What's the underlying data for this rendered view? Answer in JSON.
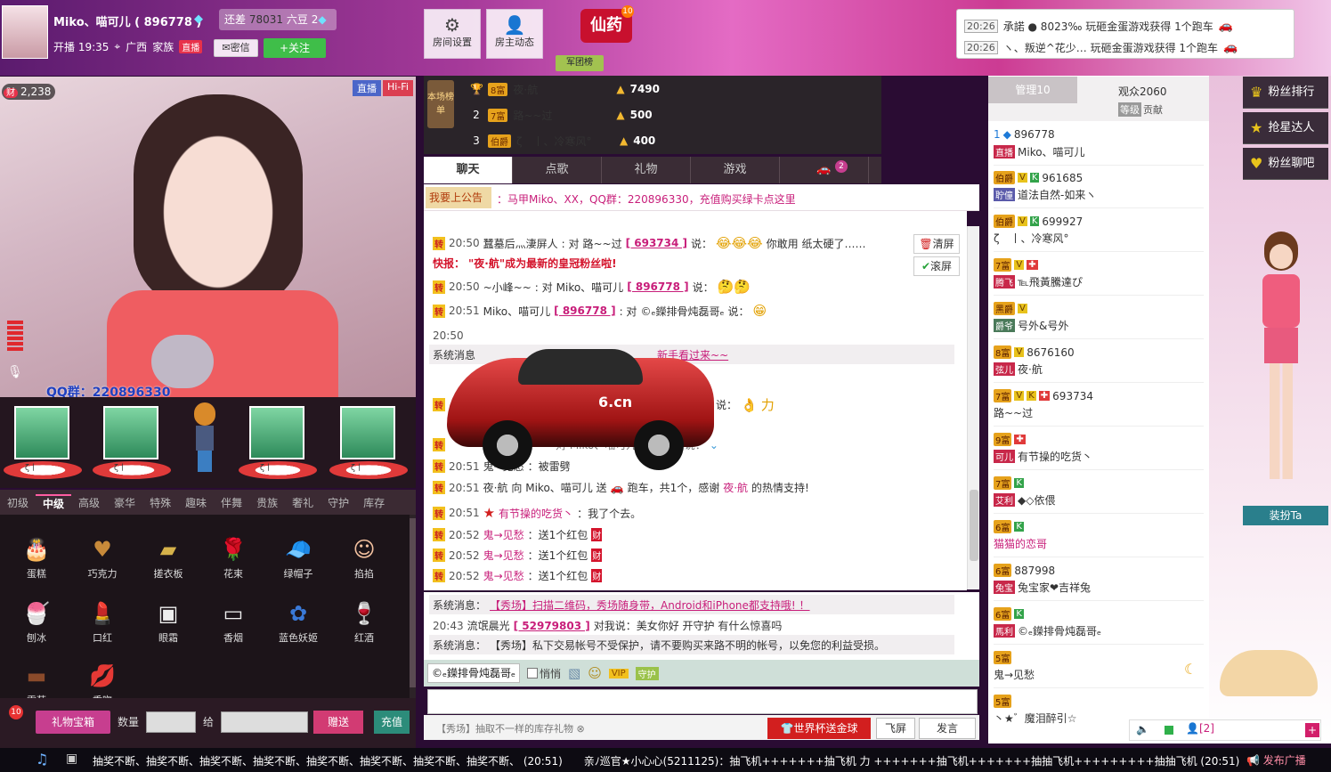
{
  "header": {
    "host_name": "Miko、喵可儿 ( 896778 )",
    "gap_label": "还差",
    "gap_value": "78031",
    "gap_unit": "六豆",
    "gap_level": "2",
    "start_label": "开播 19:35",
    "location": "广西",
    "family_label": "家族",
    "family_badge": "直播",
    "msg_btn": "密信",
    "follow_btn": "+关注",
    "room_settings": "房间设置",
    "host_updates": "房主动态",
    "xianyao": "仙药",
    "xianyao_badge": "10",
    "legion_rank": "军团榜"
  },
  "notices": [
    {
      "time": "20:26",
      "text": "承諾 ● 8023‰ 玩砸金蛋游戏获得 1个跑车"
    },
    {
      "time": "20:26",
      "text": "ヽ、叛逆^花少… 玩砸金蛋游戏获得 1个跑车"
    }
  ],
  "video": {
    "wealth": "2,238",
    "wealth_tag": "财",
    "tag_live": "直播",
    "tag_hifi": "Hi-Fi",
    "qq": "QQ群：220896330"
  },
  "podiums": [
    {
      "cap": "ζ丨"
    },
    {
      "cap": "ζ丨"
    },
    {
      "cap": "ζ丨"
    },
    {
      "cap": "ζ丨"
    }
  ],
  "gift_tabs": [
    "初级",
    "中级",
    "高级",
    "豪华",
    "特殊",
    "趣味",
    "伴舞",
    "贵族",
    "奢礼",
    "守护",
    "库存"
  ],
  "gifts": [
    {
      "name": "蛋糕",
      "icon": "cake-icon",
      "glyph": "🎂"
    },
    {
      "name": "巧克力",
      "icon": "chocolate-icon",
      "glyph": "♥"
    },
    {
      "name": "搓衣板",
      "icon": "washboard-icon",
      "glyph": "▰"
    },
    {
      "name": "花束",
      "icon": "bouquet-icon",
      "glyph": "🌹"
    },
    {
      "name": "绿帽子",
      "icon": "green-hat-icon",
      "glyph": "🧢"
    },
    {
      "name": "掐掐",
      "icon": "pinch-icon",
      "glyph": "☺"
    },
    {
      "name": "刨冰",
      "icon": "shaved-ice-icon",
      "glyph": "🍧"
    },
    {
      "name": "口红",
      "icon": "lipstick-icon",
      "glyph": "💄"
    },
    {
      "name": "眼霜",
      "icon": "eye-cream-icon",
      "glyph": "▣"
    },
    {
      "name": "香烟",
      "icon": "cigarette-icon",
      "glyph": "▭"
    },
    {
      "name": "蓝色妖姬",
      "icon": "blue-rose-icon",
      "glyph": "✿"
    },
    {
      "name": "红酒",
      "icon": "wine-icon",
      "glyph": "🍷"
    },
    {
      "name": "雪茄",
      "icon": "cigar-icon",
      "glyph": "▬"
    },
    {
      "name": "香吻",
      "icon": "kiss-icon",
      "glyph": "💋"
    }
  ],
  "gift_bottom": {
    "badge": "10",
    "box_btn": "礼物宝箱",
    "qty_label": "数量",
    "to_label": "给",
    "send_btn": "赠送",
    "recharge_btn": "充值"
  },
  "ranking": {
    "badge": "本场榜单",
    "rows": [
      {
        "rank": "1",
        "level": "8富",
        "name": "夜·航",
        "value": "7490"
      },
      {
        "rank": "2",
        "level": "7富",
        "name": "路~~过",
        "value": "500"
      },
      {
        "rank": "3",
        "level": "伯爵",
        "name": "ζ　丨、冷寒风°",
        "value": "400"
      }
    ]
  },
  "chat_tabs": [
    "聊天",
    "点歌",
    "礼物",
    "游戏",
    ""
  ],
  "car_badge": "2",
  "announce": {
    "tag": "我要上公告",
    "text": "：马甲Miko、XX，QQ群：220896330，充值购买绿卡点这里"
  },
  "chat_controls": {
    "clear": "清屏",
    "scroll": "滚屏"
  },
  "chat": {
    "l1": {
      "tag": "转",
      "time": "20:50",
      "from": "蠶墓后灬淒屏人",
      "to": "路~~过",
      "rid": "[ 693734 ]",
      "said": "说：",
      "tail": "你敢用 纸太硬了……"
    },
    "l2": {
      "prefix": "快报：",
      "text": "\"夜·航\"成为最新的皇冠粉丝啦!"
    },
    "l3": {
      "tag": "转",
      "time": "20:50",
      "from": "~小峰~~",
      "to": "Miko、喵可儿",
      "rid": "[ 896778 ]",
      "said": "说："
    },
    "l4": {
      "tag": "转",
      "time": "20:51",
      "from": "Miko、喵可儿",
      "rid": "[ 896778 ]",
      "to": "©ₑ鑅排骨炖磊哥ₑ",
      "said": "说："
    },
    "l5": {
      "time": "20:50"
    },
    "l6": {
      "label": "系统消息",
      "link": "新手看过来~~"
    },
    "l7": {
      "tag": "转",
      "said": "说：",
      "tail": "力"
    },
    "l8": {
      "tag": "转",
      "text": "对 Miko、喵可儿 896778 说："
    },
    "l9": {
      "tag": "转",
      "time": "20:51",
      "from": "鬼→见愁",
      "text": "：被雷劈"
    },
    "l10": {
      "tag": "转",
      "time": "20:51",
      "from": "夜·航",
      "mid": "向 Miko、喵可儿 送",
      "gift": "跑车，共1个，感谢",
      "who": "夜·航",
      "tail": "的热情支持!"
    },
    "l11": {
      "tag": "转",
      "time": "20:51",
      "from": "有节操的吃货丶",
      "text": "：我了个去。"
    },
    "l12": {
      "tag": "转",
      "time": "20:52",
      "from": "鬼→见愁",
      "text": "：送1个红包",
      "hb": "财"
    },
    "l13": {
      "tag": "转",
      "time": "20:52",
      "from": "鬼→见愁",
      "text": "：送1个红包",
      "hb": "财"
    },
    "l14": {
      "tag": "转",
      "time": "20:52",
      "from": "鬼→见愁",
      "text": "：送1个红包",
      "hb": "财"
    }
  },
  "sys_msgs": {
    "s1_label": "系统消息：",
    "s1_link": "【秀场】扫描二维码，秀场随身带，Android和iPhone都支持哦! ！",
    "s2_time": "20:43",
    "s2_from": "流氓晨光",
    "s2_rid": "[ 52979803 ]",
    "s2_text": "对我说：美女你好 开守护 有什么惊喜吗",
    "s3_label": "系统消息：",
    "s3_text": "【秀场】私下交易帐号不受保护，请不要购买来路不明的帐号，以免您的利益受损。"
  },
  "input_tools": {
    "target": "©ₑ鑅排骨炖磊哥ₑ",
    "whisper": "悄悄",
    "vip": "VIP",
    "guard": "守护"
  },
  "bottom": {
    "showfield": "【秀场】抽取不一样的库存礼物",
    "worldcup": "世界杯送金球",
    "fly": "飞屏",
    "speak": "发言"
  },
  "viewer_tabs": {
    "admin": "管理10",
    "viewers": "观众2060",
    "sort_level": "等级",
    "sort_contrib": "贡献"
  },
  "viewers": [
    {
      "top": "896778",
      "lv": "1",
      "sub": "Miko、喵可儿",
      "tag": "直播"
    },
    {
      "lv": "伯爵",
      "top": "961685",
      "tag": "聍僮",
      "sub": "道法自然-如来ヽ"
    },
    {
      "lv": "伯爵",
      "top": "699927",
      "sub": "ζ　丨、冷寒风°"
    },
    {
      "lv": "7富",
      "top": "",
      "tag": "腾飞",
      "sub": "℡飛黃騰達ぴ"
    },
    {
      "lv": "黑爵",
      "top": "",
      "tag": "爵爷",
      "sub": "号外&号外"
    },
    {
      "lv": "8富",
      "top": "8676160",
      "tag": "弦儿",
      "sub": "夜·航"
    },
    {
      "lv": "7富",
      "top": "693734",
      "sub": "路~~过"
    },
    {
      "lv": "9富",
      "top": "",
      "tag": "可儿",
      "sub": "有节操的吃货丶"
    },
    {
      "lv": "7富",
      "top": "",
      "tag": "艾利",
      "sub": "◆◇依偎"
    },
    {
      "lv": "6富",
      "top": "",
      "sub": "猫猫的恋哥"
    },
    {
      "lv": "6富",
      "top": "887998",
      "tag": "兔宝",
      "sub": "兔宝家❤吉祥兔"
    },
    {
      "lv": "6富",
      "top": "",
      "tag": "馬利",
      "sub": "©ₑ鑅排骨炖磊哥ₑ"
    },
    {
      "lv": "5富",
      "top": "",
      "sub": "鬼→见愁"
    },
    {
      "lv": "5富",
      "top": "",
      "sub": "丶★゛魔泪醉引☆"
    }
  ],
  "viewer_footer": {
    "count": "[2]",
    "plus": "+"
  },
  "side_buttons": [
    {
      "label": "粉丝排行",
      "icon": "crown-icon",
      "glyph": "♛"
    },
    {
      "label": "抢星达人",
      "icon": "star-icon",
      "glyph": "★"
    },
    {
      "label": "粉丝聊吧",
      "icon": "heart-icon",
      "glyph": "♥"
    }
  ],
  "dress_btn": "装扮Ta",
  "taskbar": {
    "ticker": "抽奖不断、抽奖不断、抽奖不断、抽奖不断、抽奖不断、抽奖不断、抽奖不断、抽奖不断、 (20:51)　　亲ﾉ巡官★小心心(5211125)：抽飞机+++++++抽飞机 力 +++++++抽飞机+++++++抽抽飞机+++++++++抽抽飞机 (20:51)",
    "broadcast": "发布广播"
  }
}
